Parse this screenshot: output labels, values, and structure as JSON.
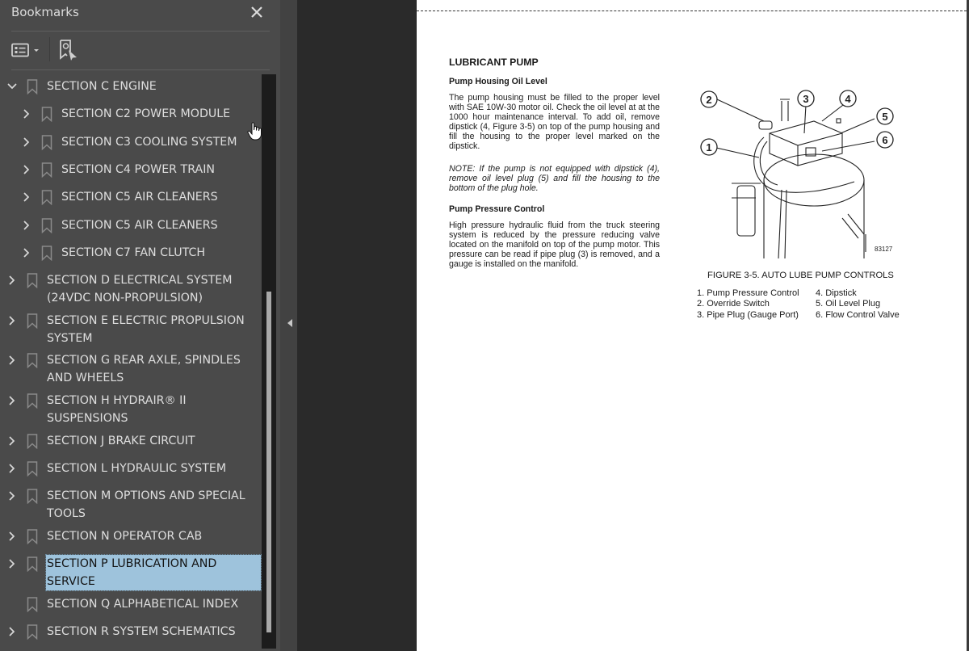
{
  "bookmarks_panel": {
    "title": "Bookmarks",
    "close_icon": "close-icon",
    "toolbar": {
      "options_icon": "list-options-icon",
      "find_icon": "find-current-bookmark-icon"
    },
    "items": [
      {
        "label": "SECTION C ENGINE",
        "level": 0,
        "expander": "expanded",
        "selected": false
      },
      {
        "label": "SECTION C2 POWER MODULE",
        "level": 1,
        "expander": "collapsed",
        "selected": false
      },
      {
        "label": "SECTION C3 COOLING SYSTEM",
        "level": 1,
        "expander": "collapsed",
        "selected": false
      },
      {
        "label": "SECTION C4 POWER TRAIN",
        "level": 1,
        "expander": "collapsed",
        "selected": false
      },
      {
        "label": "SECTION C5 AIR CLEANERS",
        "level": 1,
        "expander": "collapsed",
        "selected": false
      },
      {
        "label": "SECTION C5 AIR CLEANERS",
        "level": 1,
        "expander": "collapsed",
        "selected": false
      },
      {
        "label": "SECTION C7 FAN CLUTCH",
        "level": 1,
        "expander": "collapsed",
        "selected": false
      },
      {
        "label": "SECTION D ELECTRICAL SYSTEM\n(24VDC NON-PROPULSION)",
        "level": 0,
        "expander": "collapsed",
        "selected": false
      },
      {
        "label": "SECTION E ELECTRIC PROPULSION\nSYSTEM",
        "level": 0,
        "expander": "collapsed",
        "selected": false
      },
      {
        "label": "SECTION G REAR AXLE, SPINDLES\nAND WHEELS",
        "level": 0,
        "expander": "collapsed",
        "selected": false
      },
      {
        "label": "SECTION H HYDRAIR® II\nSUSPENSIONS",
        "level": 0,
        "expander": "collapsed",
        "selected": false
      },
      {
        "label": "SECTION J BRAKE CIRCUIT",
        "level": 0,
        "expander": "collapsed",
        "selected": false
      },
      {
        "label": "SECTION L HYDRAULIC SYSTEM",
        "level": 0,
        "expander": "collapsed",
        "selected": false
      },
      {
        "label": "SECTION M OPTIONS AND SPECIAL\nTOOLS",
        "level": 0,
        "expander": "collapsed",
        "selected": false
      },
      {
        "label": "SECTION N OPERATOR CAB",
        "level": 0,
        "expander": "collapsed",
        "selected": false
      },
      {
        "label": "SECTION P LUBRICATION AND\nSERVICE",
        "level": 0,
        "expander": "collapsed",
        "selected": true
      },
      {
        "label": "SECTION Q ALPHABETICAL INDEX",
        "level": 0,
        "expander": "none",
        "selected": false
      },
      {
        "label": "SECTION R SYSTEM SCHEMATICS",
        "level": 0,
        "expander": "collapsed",
        "selected": false
      }
    ],
    "collapse_panel_icon": "collapse-left-icon"
  },
  "document": {
    "heading": "LUBRICANT PUMP",
    "sub1": "Pump Housing Oil Level",
    "para1": "The pump housing must be filled to the proper level with SAE 10W-30 motor oil. Check the oil level at at the 1000 hour maintenance interval. To add oil, remove dipstick (4, Figure 3-5) on top of the pump housing and fill the housing to the proper level marked on the dipstick.",
    "note": "NOTE: If the pump is not equipped with dipstick (4), remove oil level plug (5) and fill the housing to the bottom of the plug hole.",
    "sub2": "Pump Pressure Control",
    "para2": "High pressure hydraulic fluid from the truck steering system is reduced by the pressure reducing valve located on the manifold on top of the pump motor. This pressure can be read if pipe plug (3) is removed, and a gauge is installed on the manifold.",
    "figure": {
      "id": "83127",
      "caption": "FIGURE 3-5. AUTO LUBE PUMP CONTROLS",
      "callouts": [
        "1",
        "2",
        "3",
        "4",
        "5",
        "6"
      ],
      "legend_left": [
        "1. Pump Pressure Control",
        "2. Override Switch",
        "3. Pipe Plug (Gauge Port)"
      ],
      "legend_right": [
        "4. Dipstick",
        "5. Oil Level Plug",
        "6. Flow Control Valve"
      ]
    }
  },
  "colors": {
    "panel_bg": "#4a4a4a",
    "viewer_bg": "#2a2a2a",
    "selection": "#9ec3dc",
    "text": "#dedede"
  }
}
